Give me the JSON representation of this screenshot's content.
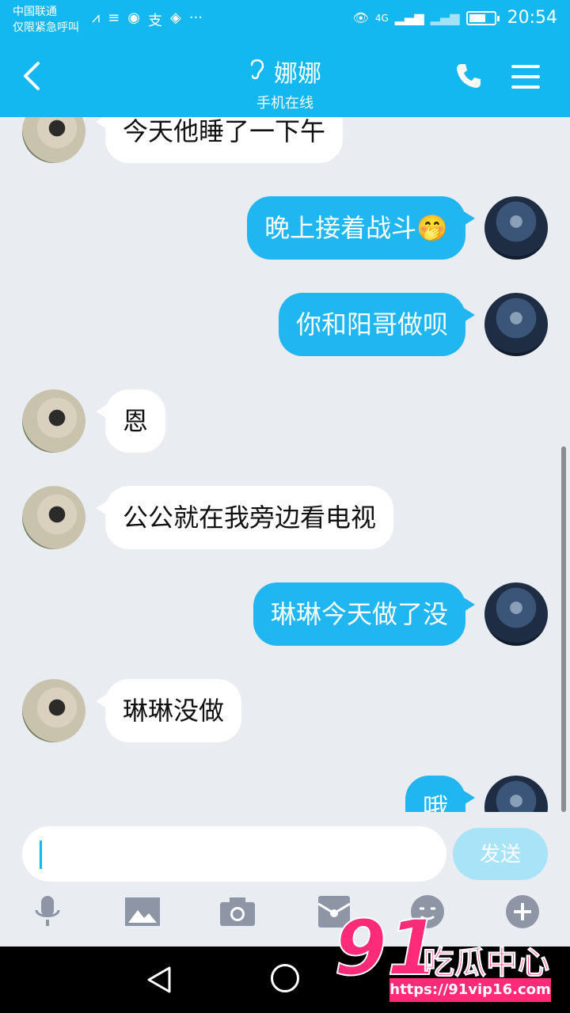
{
  "status_bar": {
    "carrier_line1": "中国联通",
    "carrier_line2": "仅限紧急呼叫",
    "time": "20:54",
    "network": "4G"
  },
  "header": {
    "contact_name": "娜娜",
    "contact_status": "手机在线"
  },
  "messages": [
    {
      "side": "in",
      "text": "今天他睡了一下午"
    },
    {
      "side": "out",
      "text": "晚上接着战斗🤭"
    },
    {
      "side": "out",
      "text": "你和阳哥做呗"
    },
    {
      "side": "in",
      "text": "恩"
    },
    {
      "side": "in",
      "text": "公公就在我旁边看电视"
    },
    {
      "side": "out",
      "text": "琳琳今天做了没"
    },
    {
      "side": "in",
      "text": "琳琳没做"
    },
    {
      "side": "out",
      "text": "哦"
    }
  ],
  "input": {
    "value": "",
    "send_label": "发送"
  },
  "toolbar": {
    "icons": [
      "microphone-icon",
      "image-icon",
      "camera-icon",
      "red-packet-icon",
      "emoji-icon",
      "plus-icon"
    ]
  },
  "watermark": {
    "number": "91",
    "text": "吃瓜中心",
    "url": "https://91vip16.com"
  },
  "colors": {
    "accent": "#14b8f0",
    "out_bubble": "#1fb6f2",
    "background": "#e9edf2"
  }
}
